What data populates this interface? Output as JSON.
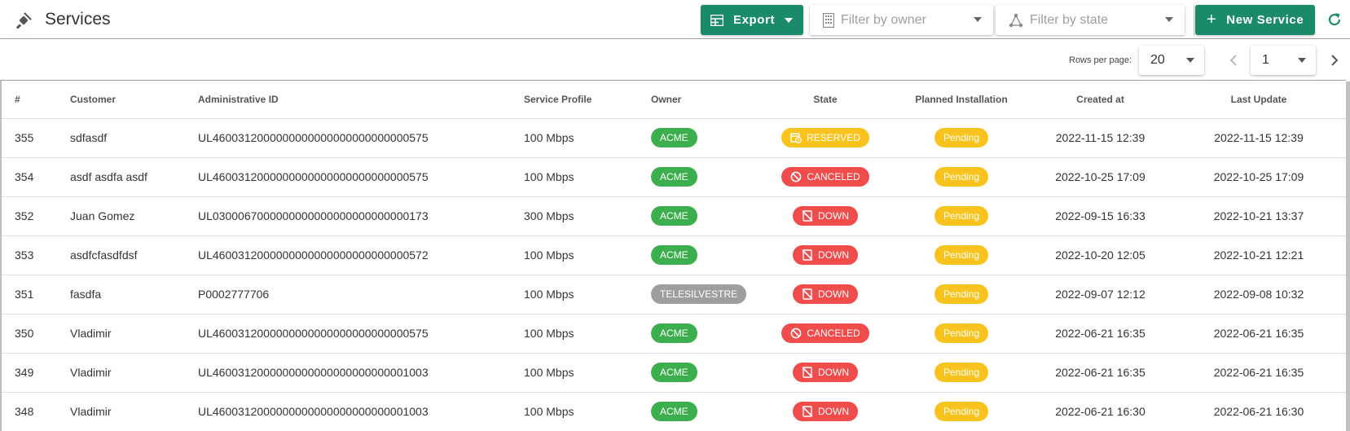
{
  "header": {
    "title": "Services",
    "export_label": "Export",
    "filter_owner_placeholder": "Filter by owner",
    "filter_state_placeholder": "Filter by state",
    "new_service_label": "New Service"
  },
  "pagination": {
    "rows_per_page_label": "Rows per page:",
    "rows_per_page_value": "20",
    "page_value": "1"
  },
  "table": {
    "columns": [
      "#",
      "Customer",
      "Administrative ID",
      "Service Profile",
      "Owner",
      "State",
      "Planned Installation",
      "Created at",
      "Last Update"
    ],
    "rows": [
      {
        "id": "355",
        "customer": "sdfasdf",
        "admin_id": "UL4600312000000000000000000000000575",
        "profile": "100 Mbps",
        "owner": "ACME",
        "state": "RESERVED",
        "planned": "Pending",
        "created": "2022-11-15 12:39",
        "updated": "2022-11-15 12:39"
      },
      {
        "id": "354",
        "customer": "asdf asdfa asdf",
        "admin_id": "UL4600312000000000000000000000000575",
        "profile": "100 Mbps",
        "owner": "ACME",
        "state": "CANCELED",
        "planned": "Pending",
        "created": "2022-10-25 17:09",
        "updated": "2022-10-25 17:09"
      },
      {
        "id": "352",
        "customer": "Juan Gomez",
        "admin_id": "UL0300067000000000000000000000000173",
        "profile": "300 Mbps",
        "owner": "ACME",
        "state": "DOWN",
        "planned": "Pending",
        "created": "2022-09-15 16:33",
        "updated": "2022-10-21 13:37"
      },
      {
        "id": "353",
        "customer": "asdfcfasdfdsf",
        "admin_id": "UL4600312000000000000000000000000572",
        "profile": "100 Mbps",
        "owner": "ACME",
        "state": "DOWN",
        "planned": "Pending",
        "created": "2022-10-20 12:05",
        "updated": "2022-10-21 12:21"
      },
      {
        "id": "351",
        "customer": "fasdfa",
        "admin_id": "P0002777706",
        "profile": "100 Mbps",
        "owner": "TELESILVESTRE",
        "state": "DOWN",
        "planned": "Pending",
        "created": "2022-09-07 12:12",
        "updated": "2022-09-08 10:32"
      },
      {
        "id": "350",
        "customer": "Vladimir",
        "admin_id": "UL4600312000000000000000000000000575",
        "profile": "100 Mbps",
        "owner": "ACME",
        "state": "CANCELED",
        "planned": "Pending",
        "created": "2022-06-21 16:35",
        "updated": "2022-06-21 16:35"
      },
      {
        "id": "349",
        "customer": "Vladimir",
        "admin_id": "UL4600312000000000000000000000001003",
        "profile": "100 Mbps",
        "owner": "ACME",
        "state": "DOWN",
        "planned": "Pending",
        "created": "2022-06-21 16:35",
        "updated": "2022-06-21 16:35"
      },
      {
        "id": "348",
        "customer": "Vladimir",
        "admin_id": "UL4600312000000000000000000000001003",
        "profile": "100 Mbps",
        "owner": "ACME",
        "state": "DOWN",
        "planned": "Pending",
        "created": "2022-06-21 16:30",
        "updated": "2022-06-21 16:30"
      }
    ]
  },
  "colors": {
    "primary": "#1b8a6b",
    "owner_acme": "#3dae4d",
    "owner_other": "#9e9e9e",
    "pending": "#f7c31c",
    "reserved": "#f7c31c",
    "canceled": "#f04c4c",
    "down": "#f04c4c"
  },
  "icons": {
    "title": "plug-icon",
    "export": "table-export-icon",
    "owner_filter": "building-icon",
    "state_filter": "graph-nodes-icon",
    "new": "plus-icon",
    "refresh": "refresh-icon",
    "reserved": "calendar-clock-icon",
    "canceled": "ban-icon",
    "down": "signal-off-icon"
  }
}
